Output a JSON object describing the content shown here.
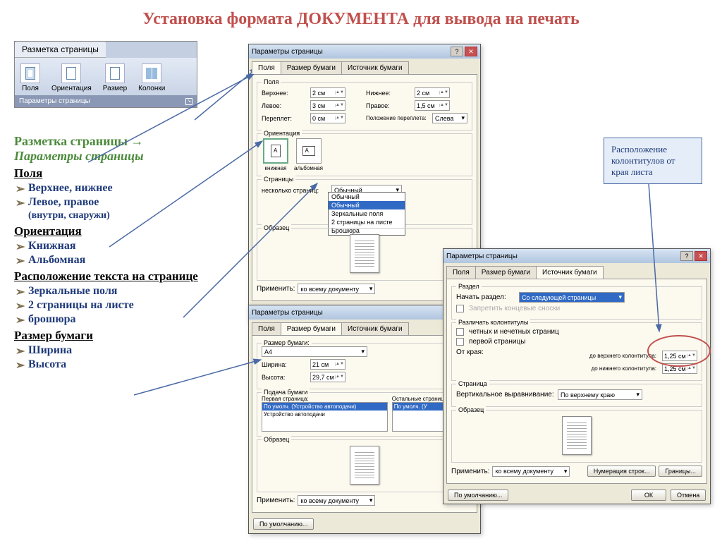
{
  "title": "Установка формата ДОКУМЕНТА для вывода на печать",
  "ribbon": {
    "tab": "Разметка страницы",
    "buttons": [
      "Поля",
      "Ориентация",
      "Размер",
      "Колонки"
    ],
    "footer": "Параметры страницы"
  },
  "left": {
    "path1": "Разметка страницы →",
    "path2": "Параметры страницы",
    "sections": [
      {
        "head": "Поля",
        "items": [
          "Верхнее, нижнее",
          "Левое, правое"
        ],
        "note": "(внутри, снаружи)"
      },
      {
        "head": "Ориентация",
        "items": [
          "Книжная",
          "Альбомная"
        ]
      },
      {
        "head": "Расположение текста на странице",
        "items": [
          "Зеркальные поля",
          "2 страницы на листе",
          "брошюра"
        ]
      },
      {
        "head": "Размер бумаги",
        "items": [
          "Ширина",
          "Высота"
        ]
      }
    ]
  },
  "callout": "Расположение колонтитулов от края листа",
  "dialogCommon": {
    "title": "Параметры страницы",
    "tabs": [
      "Поля",
      "Размер бумаги",
      "Источник бумаги"
    ],
    "applyLabel": "Применить:",
    "applyValue": "ко всему документу",
    "defaultBtn": "По умолчанию...",
    "ok": "ОК",
    "cancel": "Отмена",
    "sampleLabel": "Образец"
  },
  "dlg1": {
    "fields": {
      "top": "Верхнее:",
      "topV": "2 см",
      "left": "Левое:",
      "leftV": "3 см",
      "gutter": "Переплет:",
      "gutterV": "0 см",
      "bottom": "Нижнее:",
      "bottomV": "2 см",
      "right": "Правое:",
      "rightV": "1,5 см",
      "gutterPos": "Положение переплета:",
      "gutterPosV": "Слева"
    },
    "orientGroup": "Ориентация",
    "orientP": "книжная",
    "orientL": "альбомная",
    "pagesGroup": "Страницы",
    "multiLabel": "несколько страниц:",
    "multiOpts": [
      "Обычный",
      "Обычный",
      "Зеркальные поля",
      "2 страницы на листе",
      "Брошюра"
    ]
  },
  "dlg2": {
    "paperGroup": "Размер бумаги:",
    "paper": "A4",
    "width": "Ширина:",
    "widthV": "21 см",
    "height": "Высота:",
    "heightV": "29,7 см",
    "feedGroup": "Подача бумаги",
    "firstPage": "Первая страница:",
    "otherPages": "Остальные страницы:",
    "feedOpt1": "По умолч. (Устройство автоподачи)",
    "feedOpt2": "Устройство автоподачи",
    "feedOpt3": "По умолч. (У"
  },
  "dlg3": {
    "sectionGroup": "Раздел",
    "startLabel": "Начать раздел:",
    "startValue": "Со следующей страницы",
    "suppressEndnotes": "Запретить концевые сноски",
    "headFootGroup": "Различать колонтитулы",
    "oddEven": "четных и нечетных страниц",
    "firstPg": "первой страницы",
    "fromEdge": "От края:",
    "toHeader": "до верхнего колонтитула:",
    "toFooter": "до нижнего колонтитула:",
    "hfValue": "1,25 см",
    "pageGroup": "Страница",
    "vAlignLabel": "Вертикальное выравнивание:",
    "vAlignValue": "По верхнему краю",
    "lineNumbers": "Нумерация строк...",
    "borders": "Границы..."
  }
}
